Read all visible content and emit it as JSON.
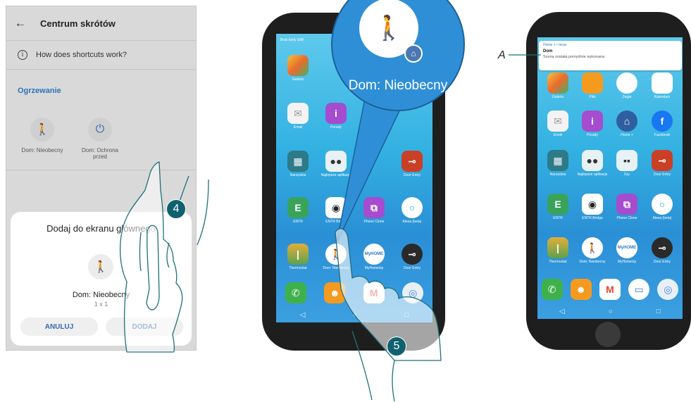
{
  "panel1": {
    "title": "Centrum skrótów",
    "back_icon": "arrow-left-icon",
    "help_text": "How does shortcuts work?",
    "section": "Ogrzewanie",
    "shortcuts": [
      {
        "label": "Dom: Nieobecny",
        "icon": "walking-person-icon"
      },
      {
        "label": "Dom: Ochrona przed",
        "icon": "power-icon"
      }
    ],
    "dialog": {
      "title": "Dodaj do ekranu głównego",
      "name": "Dom: Nieobecny",
      "size": "1 x 1",
      "cancel": "ANULUJ",
      "add": "DODAJ"
    }
  },
  "steps": {
    "four": "4",
    "five": "5"
  },
  "phone2": {
    "status": "Brak karty SIM",
    "bubble_text": "Dom: Nieobecny",
    "apps": [
      {
        "label": "Galeria",
        "color": "#e96b2d"
      },
      {
        "label": "Email",
        "color": "#f3f3f3"
      },
      {
        "label": "Porady",
        "color": "#a54ccf"
      },
      {
        "label": "Narzędzia",
        "color": "#2d7a88"
      },
      {
        "label": "Najlepsze aplikacje",
        "color": "#e8f1f5"
      },
      {
        "label": "Door Entry",
        "color": "#c94026"
      },
      {
        "label": "ENTR",
        "color": "#3aa35b"
      },
      {
        "label": "ENTR Bridge",
        "color": "#222222"
      },
      {
        "label": "Phone Clone",
        "color": "#a54ccf"
      },
      {
        "label": "Alexa (beta)",
        "color": "#2aa9e0"
      },
      {
        "label": "Thermostat",
        "color": "#7aa87a"
      },
      {
        "label": "Dom: Nieobecny",
        "color": "#ffffff"
      },
      {
        "label": "MyHomeUp",
        "color": "#ffffff"
      },
      {
        "label": "Door Entry",
        "color": "#2a2a2a"
      }
    ]
  },
  "phone3": {
    "notification": {
      "app": "Home + • teraz",
      "title": "Dom",
      "body": "Scena została pomyślnie wykonana"
    },
    "callout": "A",
    "apps": [
      {
        "label": "Galeria"
      },
      {
        "label": "Pliki"
      },
      {
        "label": "Zegar"
      },
      {
        "label": "Kalendarz"
      },
      {
        "label": "Email"
      },
      {
        "label": "Porady"
      },
      {
        "label": "Home +"
      },
      {
        "label": "Facebook"
      },
      {
        "label": "Narzędzia"
      },
      {
        "label": "Najlepsze aplikacje"
      },
      {
        "label": "Gry"
      },
      {
        "label": "Door Entry"
      },
      {
        "label": "ENTR"
      },
      {
        "label": "ENTR Bridge"
      },
      {
        "label": "Phone Clone"
      },
      {
        "label": "Alexa (beta)"
      },
      {
        "label": "Thermostat"
      },
      {
        "label": "Dom: Nieobecny"
      },
      {
        "label": "MyHomeUp"
      },
      {
        "label": "Door Entry"
      }
    ]
  }
}
